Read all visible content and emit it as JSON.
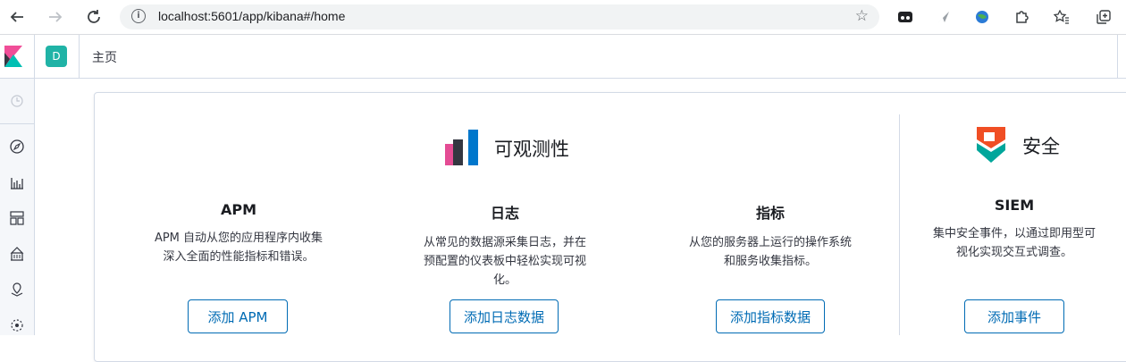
{
  "browser": {
    "url": "localhost:5601/app/kibana#/home",
    "info_glyph": "i"
  },
  "header": {
    "space_initial": "D",
    "breadcrumb": "主页"
  },
  "solutions": {
    "observability": {
      "title": "可观测性",
      "logo_colors": [
        "#e44c94",
        "#343741",
        "#0077cc"
      ]
    },
    "security": {
      "title": "安全",
      "logo_colors": [
        "#f04e24",
        "#00a69b"
      ]
    }
  },
  "cards": [
    {
      "title": "APM",
      "desc": "APM 自动从您的应用程序内收集深入全面的性能指标和错误。",
      "button": "添加 APM"
    },
    {
      "title": "日志",
      "desc": "从常见的数据源采集日志，并在预配置的仪表板中轻松实现可视化。",
      "button": "添加日志数据"
    },
    {
      "title": "指标",
      "desc": "从您的服务器上运行的操作系统和服务收集指标。",
      "button": "添加指标数据"
    },
    {
      "title": "SIEM",
      "desc": "集中安全事件，以通过即用型可视化实现交互式调查。",
      "button": "添加事件"
    }
  ],
  "colors": {
    "accent": "#006bb4",
    "space_avatar": "#20b3a6"
  }
}
